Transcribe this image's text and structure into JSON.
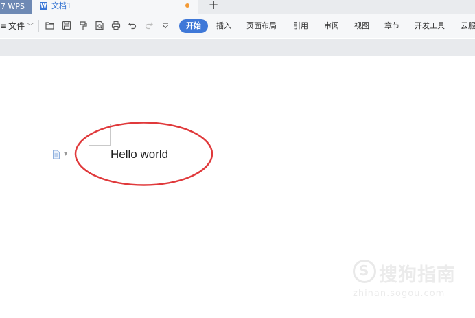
{
  "tabs": {
    "app_label": "WPS",
    "app_prefix": "7",
    "document_title": "文档1",
    "doc_icon_letter": "W",
    "new_tab_label": "+"
  },
  "menubar": {
    "file_label": "文件",
    "start_label": "开始",
    "items": [
      "插入",
      "页面布局",
      "引用",
      "审阅",
      "视图",
      "章节",
      "开发工具",
      "云服"
    ]
  },
  "quick_access": [
    "open-icon",
    "save-icon",
    "format-painter-icon",
    "print-preview-icon",
    "print-icon",
    "undo-icon",
    "redo-icon",
    "more-icon"
  ],
  "document": {
    "text": "Hello world"
  },
  "annotation": {
    "ellipse_color": "#e0393b"
  },
  "watermark": {
    "name": "搜狗指南",
    "url": "zhinan.sogou.com",
    "logo_glyph": "S"
  },
  "colors": {
    "accent": "#3f78d8",
    "app_tab": "#6e89b4",
    "unsaved_dot": "#f39a36"
  }
}
